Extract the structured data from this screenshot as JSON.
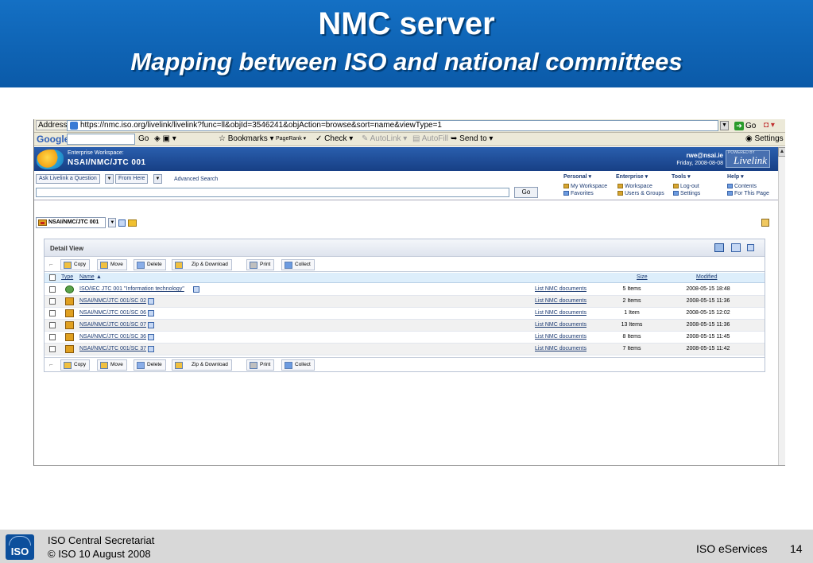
{
  "slide": {
    "title": "NMC server",
    "subtitle": "Mapping between ISO and national committees"
  },
  "browser": {
    "address_label": "Address",
    "url": "https://nmc.iso.org/livelink/livelink?func=ll&objId=3546241&objAction=browse&sort=name&viewType=1",
    "go_label": "Go",
    "google_logo": "Google",
    "google_go": "Go",
    "bookmarks": "Bookmarks",
    "pagerank": "PageRank",
    "check": "Check",
    "autolink": "AutoLink",
    "autofill": "AutoFill",
    "send_to": "Send to",
    "settings": "Settings"
  },
  "livelink": {
    "workspace_label": "Enterprise Workspace:",
    "workspace_name": "NSAI/NMC/JTC 001",
    "user": "rwe@nsai.ie",
    "date": "Friday, 2008-08-08",
    "brand": "Livelink",
    "brand_small": "POWERED BY",
    "ask_livelink": "Ask Livelink a Question",
    "from_here": "From Here",
    "advanced_search": "Advanced Search",
    "search_go": "Go",
    "menus": {
      "personal": "Personal",
      "enterprise": "Enterprise",
      "tools": "Tools",
      "help": "Help",
      "my_workspace": "My Workspace",
      "favorites": "Favorites",
      "workspace": "Workspace",
      "users_groups": "Users & Groups",
      "logout": "Log-out",
      "settings": "Settings",
      "contents": "Contents",
      "for_this_page": "For This Page"
    },
    "breadcrumb": "NSAI/NMC/JTC 001"
  },
  "detail_view": {
    "title": "Detail View",
    "actions": [
      "Copy",
      "Move",
      "Delete",
      "Zip & Download",
      "Print",
      "Collect"
    ],
    "columns": {
      "type": "Type",
      "name": "Name",
      "size": "Size",
      "modified": "Modified"
    },
    "rows": [
      {
        "name": "ISO/IEC JTC 001 \"Information technology\"",
        "list": "List NMC documents",
        "size": "5 Items",
        "modified": "2008-05-15 18:48"
      },
      {
        "name": "NSAI/NMC/JTC 001/SC 02",
        "list": "List NMC documents",
        "size": "2 Items",
        "modified": "2008-05-15 11:36"
      },
      {
        "name": "NSAI/NMC/JTC 001/SC 06",
        "list": "List NMC documents",
        "size": "1 Item",
        "modified": "2008-05-15 12:02"
      },
      {
        "name": "NSAI/NMC/JTC 001/SC 07",
        "list": "List NMC documents",
        "size": "13 Items",
        "modified": "2008-05-15 11:36"
      },
      {
        "name": "NSAI/NMC/JTC 001/SC 36",
        "list": "List NMC documents",
        "size": "8 Items",
        "modified": "2008-05-15 11:45"
      },
      {
        "name": "NSAI/NMC/JTC 001/SC 37",
        "list": "List NMC documents",
        "size": "7 Items",
        "modified": "2008-05-15 11:42"
      }
    ]
  },
  "footer": {
    "org": "ISO Central Secretariat",
    "copyright": "© ISO 10 August 2008",
    "service": "ISO eServices",
    "page": "14",
    "logo_text": "ISO"
  }
}
